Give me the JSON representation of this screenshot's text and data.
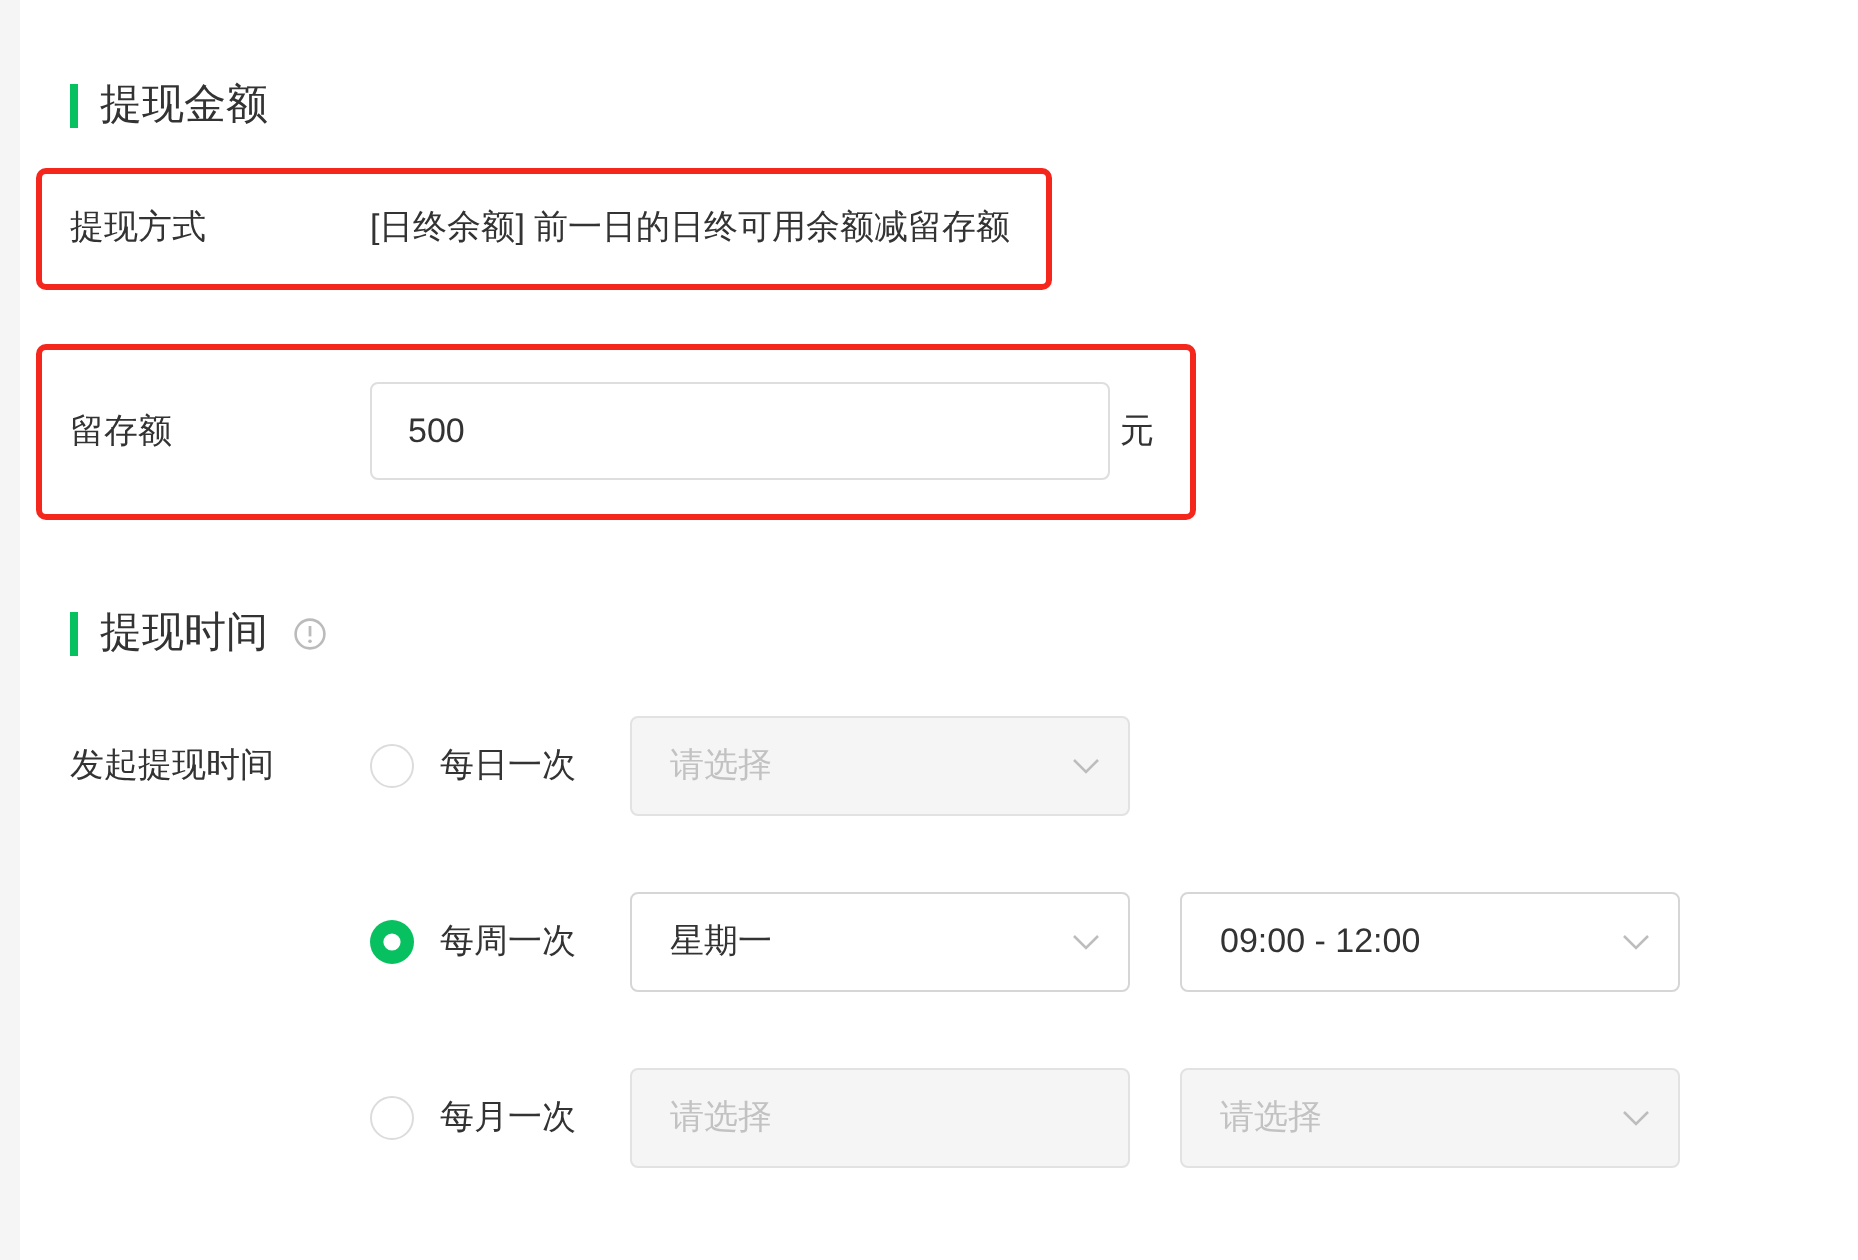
{
  "sections": [
    {
      "title": "提现金额",
      "rows": [
        {
          "kind": "text",
          "label": "提现方式",
          "value": "[日终余额] 前一日的日终可用余额减留存额",
          "highlighted": true
        },
        {
          "kind": "input",
          "label": "留存额",
          "value": "500",
          "unit": "元",
          "highlighted": true
        }
      ]
    },
    {
      "title": "提现时间",
      "info_icon": true,
      "rows": [
        {
          "kind": "radio-group",
          "label": "发起提现时间",
          "options": [
            {
              "label": "每日一次",
              "selected": false,
              "selects": [
                {
                  "placeholder": "请选择",
                  "disabled": true,
                  "chevron": true
                }
              ]
            },
            {
              "label": "每周一次",
              "selected": true,
              "selects": [
                {
                  "value": "星期一",
                  "disabled": false,
                  "chevron": true
                },
                {
                  "value": "09:00 - 12:00",
                  "disabled": false,
                  "chevron": true
                }
              ]
            },
            {
              "label": "每月一次",
              "selected": false,
              "selects": [
                {
                  "placeholder": "请选择",
                  "disabled": true,
                  "chevron": false
                },
                {
                  "placeholder": "请选择",
                  "disabled": true,
                  "chevron": true
                }
              ]
            }
          ]
        }
      ]
    }
  ]
}
